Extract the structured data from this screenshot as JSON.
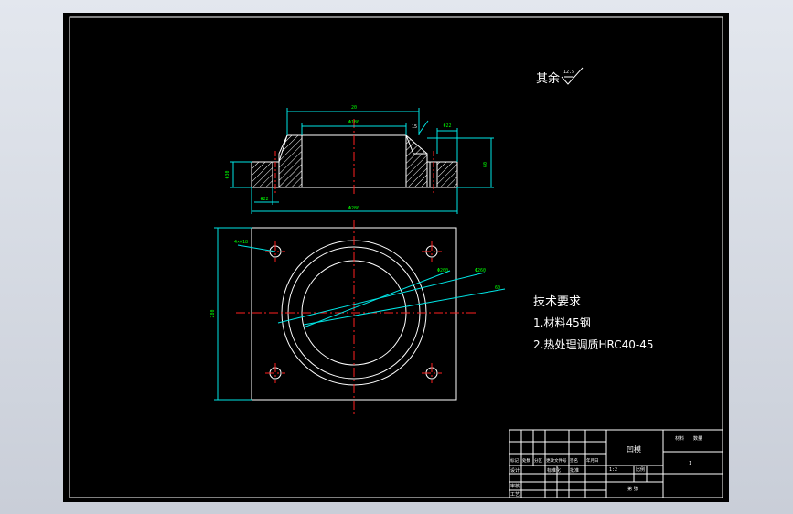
{
  "drawing": {
    "surface_note": "其余",
    "surface_symbol_value": "12.5",
    "tech_req_title": "技术要求",
    "tech_req_items": [
      "1.材料45钢",
      "2.热处理调质HRC40-45"
    ],
    "dimensions": {
      "top_width": "Φ180",
      "outer_width": "Φ280",
      "boss_height": "20",
      "right_height": "60",
      "left_height": "Φ22",
      "hole_dia": "Φ22",
      "left_overall": "Φ30",
      "plate_height": "280",
      "hole_tag": "4×Φ18",
      "chamfer": "15",
      "leader_a": "Φ200",
      "leader_b": "Φ260"
    },
    "title_block": {
      "part_name": "凹模",
      "scale_caption": "比例",
      "quantity_caption": "数量",
      "material_caption": "材料",
      "page": "1",
      "scale_value": "1:2",
      "sheet_caption": "第 张",
      "designer": "设计",
      "checker": "审核",
      "process": "工艺",
      "std": "标准化",
      "approve": "批准",
      "row_labels": [
        "标记",
        "处数",
        "分区",
        "更改文件号",
        "签名",
        "年月日"
      ]
    }
  },
  "colors": {
    "background": "#000000",
    "frame": "#ffffff",
    "centerline": "#ff2020",
    "dimension": "#00e6e6",
    "dimension_text": "#00ff00",
    "hatch": "#ffffff"
  }
}
